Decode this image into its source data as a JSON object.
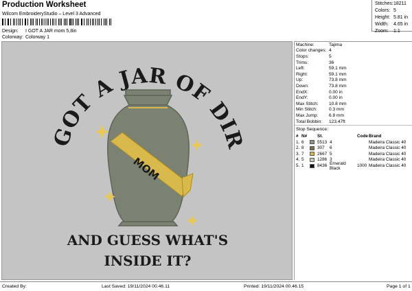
{
  "header": {
    "title": "Production Worksheet",
    "subtitle": "Wilcom EmbroideryStudio – Level 3 Advanced",
    "design_label": "Design:",
    "design_value": "I GOT A JAR mom 5,8in",
    "colorway_label": "Colorway:",
    "colorway_value": "Colorway 1"
  },
  "summary": [
    {
      "key": "Stitches:",
      "value": "18211"
    },
    {
      "key": "Colors:",
      "value": "5"
    },
    {
      "key": "Height:",
      "value": "5.81 in"
    },
    {
      "key": "Width:",
      "value": "4.65 in"
    },
    {
      "key": "Zoom:",
      "value": "1:1"
    }
  ],
  "artwork": {
    "top_text": "I GOT A JAR OF DIRT",
    "sash_text": "MOM",
    "bottom_line1": "AND GUESS WHAT'S",
    "bottom_line2": "INSIDE IT?",
    "colors": {
      "background": "#c4c4c4",
      "urn": "#7b8272",
      "urn_dark": "#5e6457",
      "sash": "#d9b84c",
      "text": "#1a1a1a",
      "star": "#e6c85c"
    }
  },
  "stats": [
    {
      "key": "Machine:",
      "value": "Tajima"
    },
    {
      "key": "Color changes:",
      "value": "4"
    },
    {
      "key": "Stops:",
      "value": "5"
    },
    {
      "key": "Trims:",
      "value": "36"
    },
    {
      "key": "Left:",
      "value": "59.1 mm"
    },
    {
      "key": "Right:",
      "value": "59.1 mm"
    },
    {
      "key": "Up:",
      "value": "73.8 mm"
    },
    {
      "key": "Down:",
      "value": "73.8 mm"
    },
    {
      "key": "EndX:",
      "value": "0.00 in"
    },
    {
      "key": "EndY:",
      "value": "0.00 in"
    },
    {
      "key": "Max Stitch:",
      "value": "10.8 mm"
    },
    {
      "key": "Min Stitch:",
      "value": "0.3 mm"
    },
    {
      "key": "Max Jump:",
      "value": "6.8 mm"
    },
    {
      "key": "Total Bobbin:",
      "value": "123.47ft"
    }
  ],
  "stop_sequence": {
    "label": "Stop Sequence:",
    "headers": [
      "#",
      "N#",
      "St.",
      "Code",
      "Brand"
    ],
    "rows": [
      {
        "n": "1.",
        "nr": "6",
        "color": "#8f9482",
        "stitches": "5513",
        "name": "4",
        "code": "",
        "brand": "Madeira Classic 40"
      },
      {
        "n": "2.",
        "nr": "8",
        "color": "#7a6f4e",
        "stitches": "307",
        "name": "6",
        "code": "",
        "brand": "Madeira Classic 40"
      },
      {
        "n": "3.",
        "nr": "7",
        "color": "#d7b45a",
        "stitches": "2667",
        "name": "5",
        "code": "",
        "brand": "Madeira Classic 40"
      },
      {
        "n": "4.",
        "nr": "5",
        "color": "#c9c6b8",
        "stitches": "1286",
        "name": "3",
        "code": "",
        "brand": "Madeira Classic 40"
      },
      {
        "n": "5.",
        "nr": "1",
        "color": "#111111",
        "stitches": "8436",
        "name": "Emerald Black",
        "code": "1000",
        "brand": "Madeira Classic 40"
      }
    ]
  },
  "footer": {
    "created_by": "Created By:",
    "last_saved": "Last Saved: 19/11/2024 00.46.11",
    "printed": "Printed: 19/11/2024 00.46.15",
    "page": "Page 1 of 1"
  }
}
